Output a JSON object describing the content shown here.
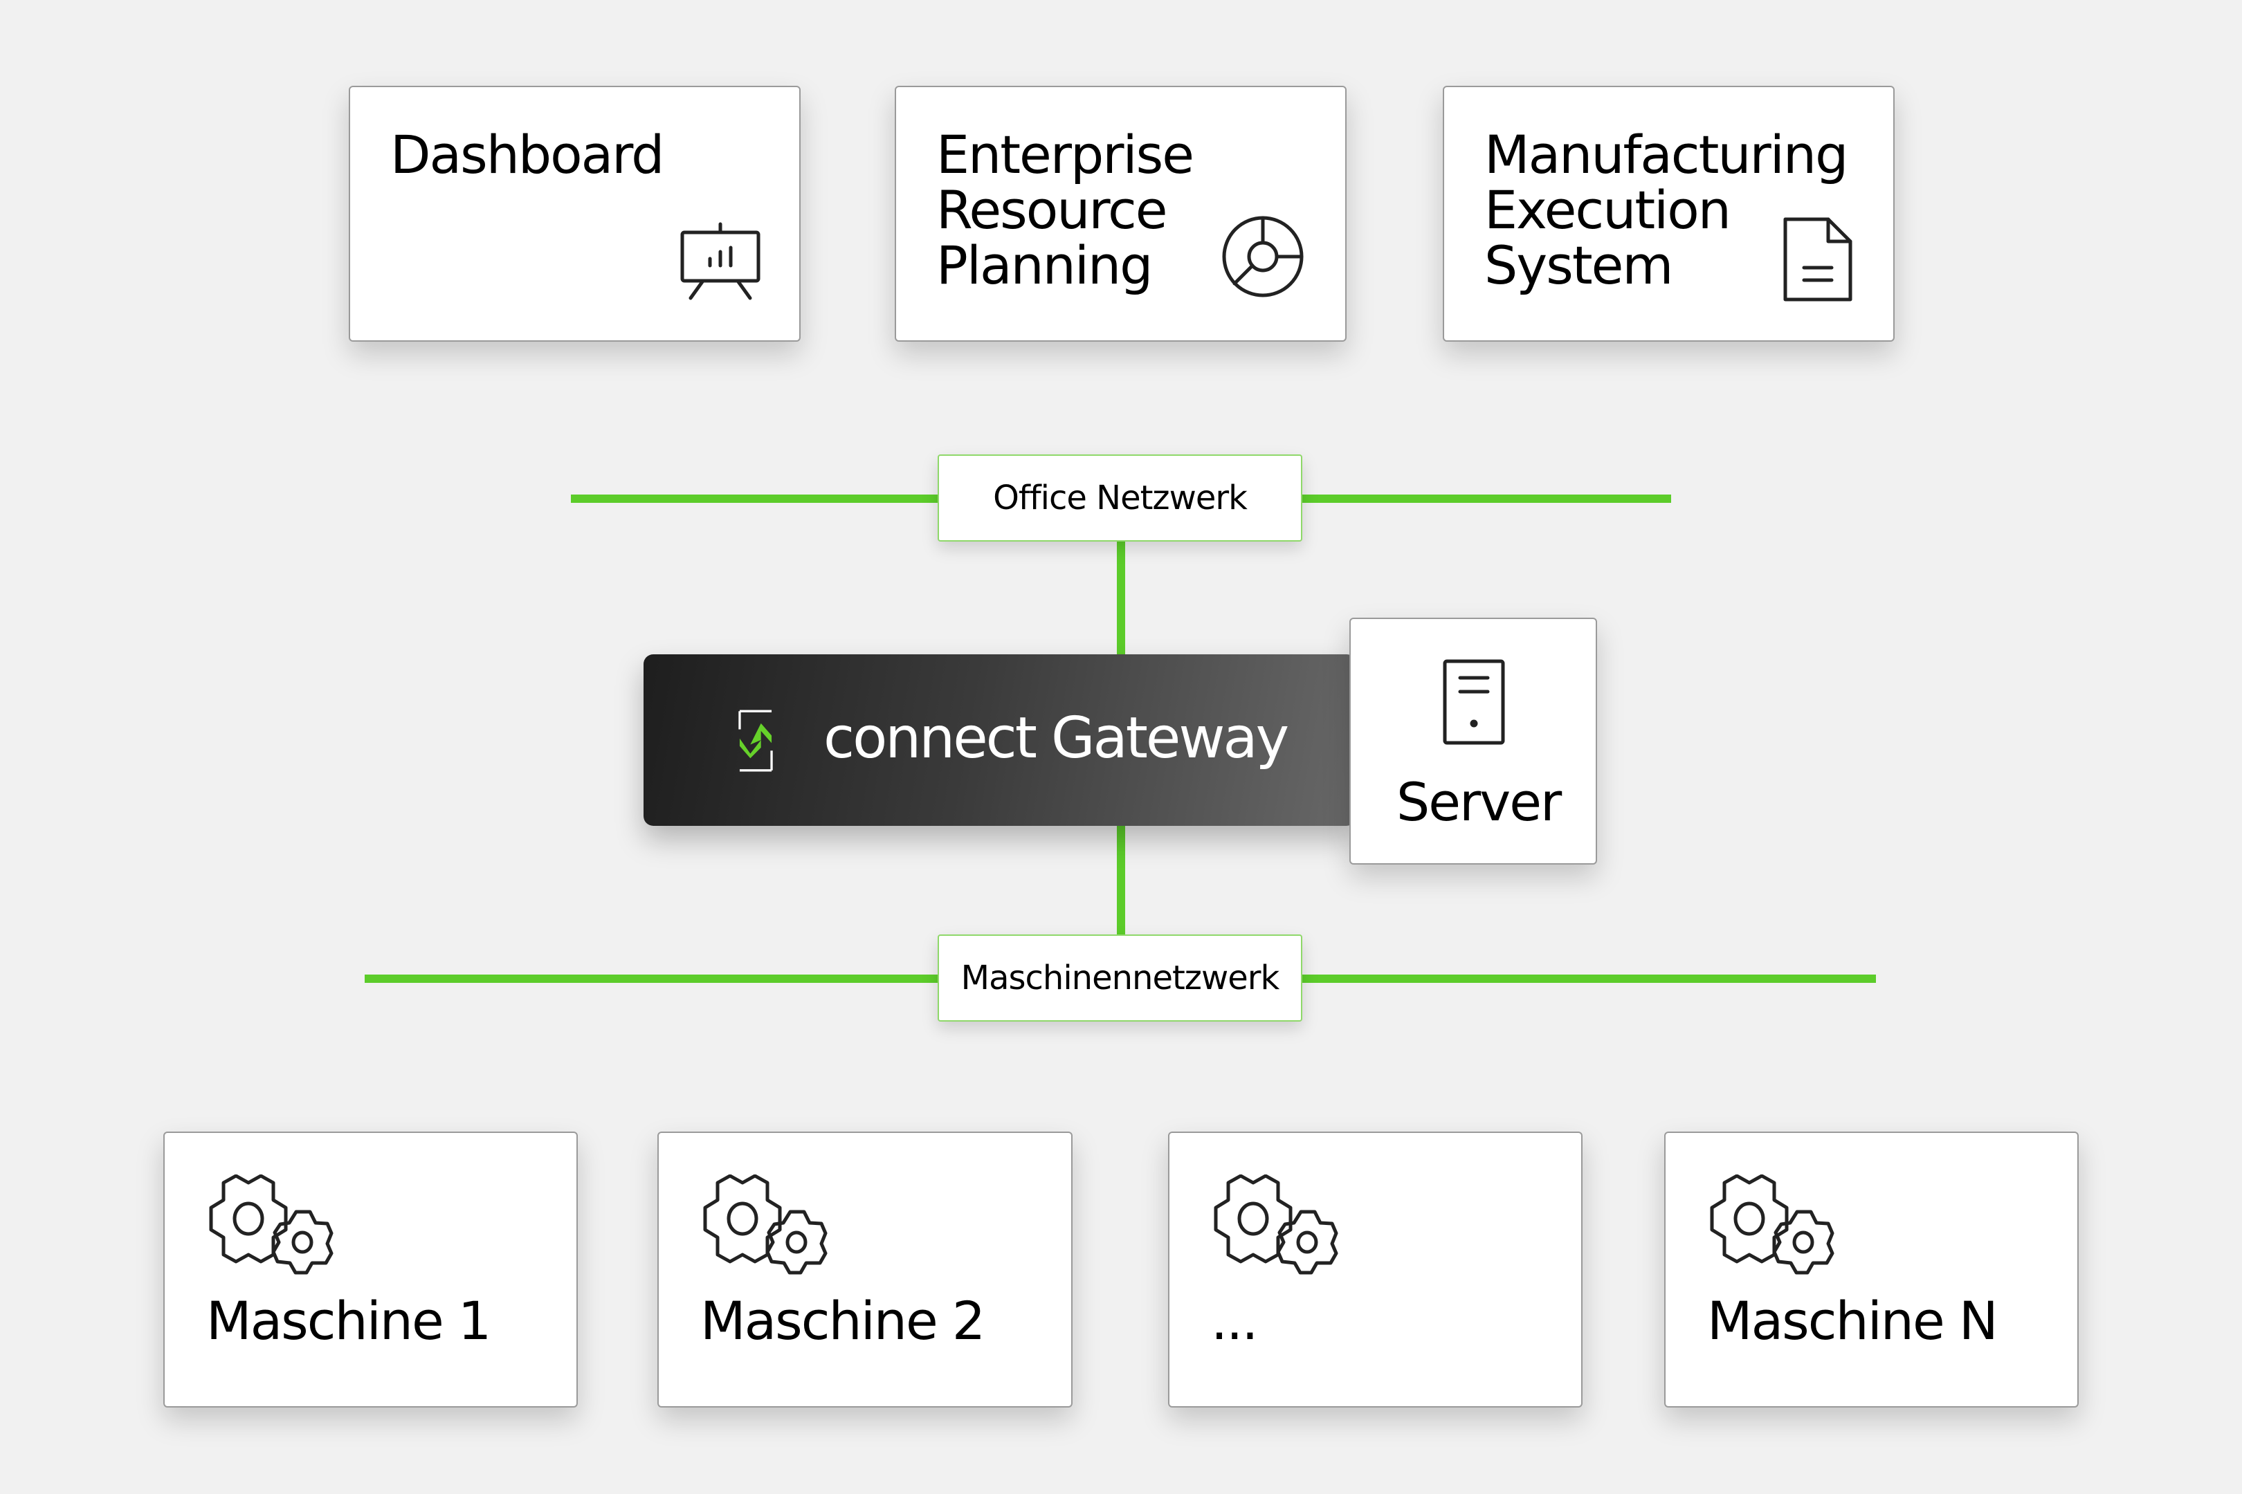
{
  "top_systems": [
    {
      "title": "Dashboard",
      "icon": "presentation-chart-icon"
    },
    {
      "title": "Enterprise\nResource\nPlanning",
      "icon": "pie-chart-icon"
    },
    {
      "title": "Manufacturing\nExecution\nSystem",
      "icon": "document-icon"
    }
  ],
  "office_network": {
    "label": "Office Netzwerk"
  },
  "gateway": {
    "label": "connect Gateway",
    "icon": "connect-logo-icon"
  },
  "server": {
    "label": "Server",
    "icon": "server-icon"
  },
  "machine_network": {
    "label": "Maschinennetzwerk"
  },
  "machines": [
    {
      "title": "Maschine 1",
      "icon": "gears-icon"
    },
    {
      "title": "Maschine 2",
      "icon": "gears-icon"
    },
    {
      "title": "...",
      "icon": "gears-icon"
    },
    {
      "title": "Maschine N",
      "icon": "gears-icon"
    }
  ],
  "colors": {
    "line_green": "#5ccc2a",
    "line_teal": "#0b9a8c",
    "logo_green": "#66d12a",
    "gateway_dark": "#1e1e1e"
  }
}
